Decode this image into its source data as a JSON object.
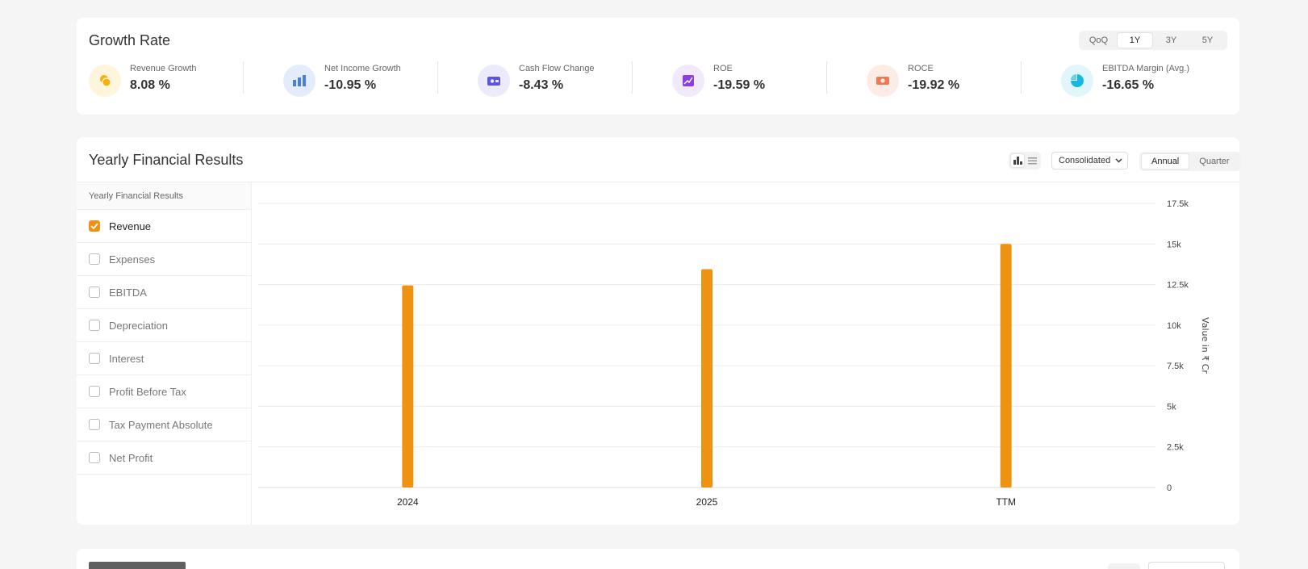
{
  "growth": {
    "title": "Growth Rate",
    "periods": [
      "QoQ",
      "1Y",
      "3Y",
      "5Y"
    ],
    "active_period": "1Y",
    "metrics": [
      {
        "label": "Revenue Growth",
        "value": "8.08 %",
        "icon": "coins-icon",
        "bg": "#fff4dc",
        "fg": "#f2b20f"
      },
      {
        "label": "Net Income Growth",
        "value": "-10.95 %",
        "icon": "bar-chart-icon",
        "bg": "#e3ecfb",
        "fg": "#4a7fe0"
      },
      {
        "label": "Cash Flow Change",
        "value": "-8.43 %",
        "icon": "cash-icon",
        "bg": "#ecebfd",
        "fg": "#5a54e0"
      },
      {
        "label": "ROE",
        "value": "-19.59 %",
        "icon": "growth-chart-icon",
        "bg": "#f1e9fc",
        "fg": "#8b3fe0"
      },
      {
        "label": "ROCE",
        "value": "-19.92 %",
        "icon": "money-icon",
        "bg": "#fdece6",
        "fg": "#ee7a55"
      },
      {
        "label": "EBITDA Margin (Avg.)",
        "value": "-16.65 %",
        "icon": "pie-chart-icon",
        "bg": "#e0f6fb",
        "fg": "#16b8e0"
      }
    ]
  },
  "yearly": {
    "title": "Yearly Financial Results",
    "view_toggle": [
      "bar-chart-icon",
      "list-icon"
    ],
    "dropdown": "Consolidated",
    "frequency": [
      "Annual",
      "Quarter"
    ],
    "active_frequency": "Annual",
    "sidebar_title": "Yearly Financial Results",
    "options": [
      {
        "label": "Revenue",
        "checked": true
      },
      {
        "label": "Expenses",
        "checked": false
      },
      {
        "label": "EBITDA",
        "checked": false
      },
      {
        "label": "Depreciation",
        "checked": false
      },
      {
        "label": "Interest",
        "checked": false
      },
      {
        "label": "Profit Before Tax",
        "checked": false
      },
      {
        "label": "Tax Payment Absolute",
        "checked": false
      },
      {
        "label": "Net Profit",
        "checked": false
      }
    ]
  },
  "chart_data": {
    "type": "bar",
    "categories": [
      "2024",
      "2025",
      "TTM"
    ],
    "series": [
      {
        "name": "Revenue",
        "values": [
          12450,
          13450,
          15000
        ],
        "color": "#ee9212"
      }
    ],
    "ylabel": "Value in ₹ Cr",
    "ylim": [
      0,
      17500
    ],
    "yticks": [
      0,
      2500,
      5000,
      7500,
      10000,
      12500,
      15000,
      17500
    ],
    "ytick_labels": [
      "0",
      "2.5k",
      "5k",
      "7.5k",
      "10k",
      "12.5k",
      "15k",
      "17.5k"
    ],
    "y_axis_position": "right",
    "grid": true
  }
}
